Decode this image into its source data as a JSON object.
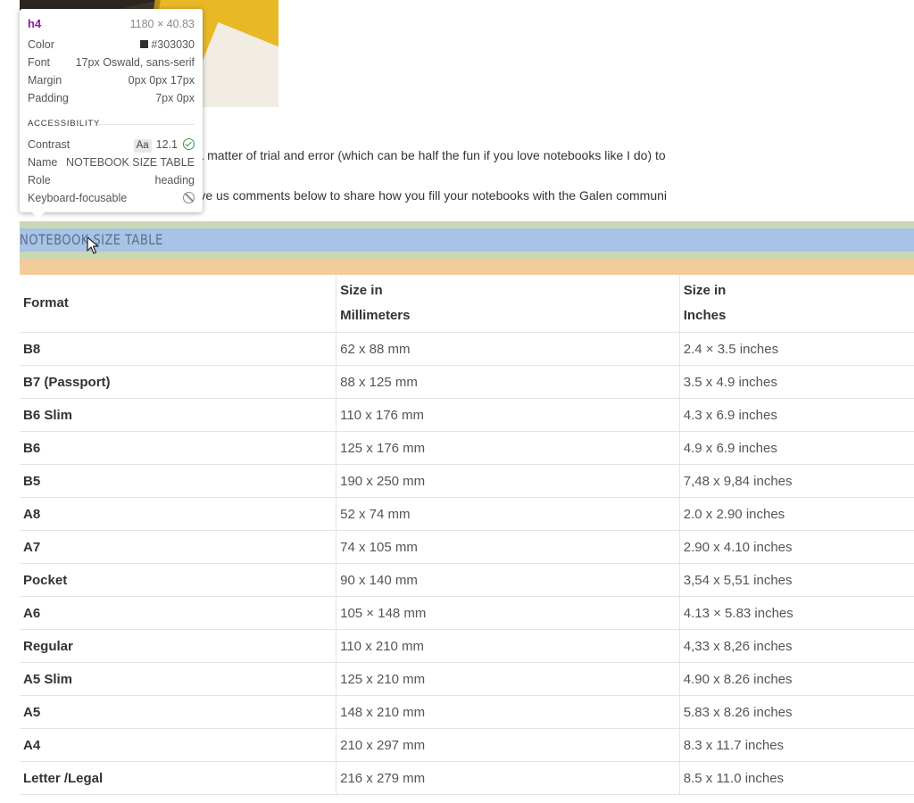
{
  "article": {
    "paragraph_1": "ok for your every need. It is just a matter of trial and error (which can be half the fun if you love notebooks like I do) to",
    "paragraph_2": "hoose to use different sizes. Leave us comments below to share how you fill your notebooks with the Galen communi",
    "section_heading": "NOTEBOOK SIZE TABLE"
  },
  "table": {
    "headers": {
      "format": "Format",
      "mm_line1": "Size in",
      "mm_line2": "Millimeters",
      "in_line1": "Size in",
      "in_line2": "Inches"
    },
    "rows": [
      {
        "format": "B8",
        "mm": "62 x 88 mm",
        "inches": "2.4 × 3.5 inches"
      },
      {
        "format": "B7 (Passport)",
        "mm": "88 x 125 mm",
        "inches": "3.5 x 4.9 inches"
      },
      {
        "format": "B6 Slim",
        "mm": "110 x 176 mm",
        "inches": "4.3 x 6.9 inches"
      },
      {
        "format": "B6",
        "mm": "125 x 176 mm",
        "inches": "4.9 x 6.9 inches"
      },
      {
        "format": "B5",
        "mm": "190 x 250 mm",
        "inches": "7,48 x 9,84 inches"
      },
      {
        "format": "A8",
        "mm": "52 x 74 mm",
        "inches": "2.0 x 2.90 inches"
      },
      {
        "format": "A7",
        "mm": "74 x 105 mm",
        "inches": "2.90 x 4.10 inches"
      },
      {
        "format": "Pocket",
        "mm": "90 x 140 mm",
        "inches": "3,54 x 5,51 inches"
      },
      {
        "format": "A6",
        "mm": "105 × 148 mm",
        "inches": "4.13 × 5.83 inches"
      },
      {
        "format": "Regular",
        "mm": "110 x 210 mm",
        "inches": "4,33 x 8,26 inches"
      },
      {
        "format": "A5 Slim",
        "mm": "125 x 210 mm",
        "inches": "4.90 x 8.26  inches"
      },
      {
        "format": "A5",
        "mm": "148 x 210 mm",
        "inches": "5.83 x 8.26  inches"
      },
      {
        "format": "A4",
        "mm": "210 x 297 mm",
        "inches": "8.3 x 11.7 inches"
      },
      {
        "format": "Letter /Legal",
        "mm": "216 x 279 mm",
        "inches": "8.5 x 11.0 inches"
      }
    ]
  },
  "inspector": {
    "tag": "h4",
    "dimensions": "1180 × 40.83",
    "color_label": "Color",
    "color_value": "#303030",
    "font_label": "Font",
    "font_value": "17px Oswald, sans-serif",
    "margin_label": "Margin",
    "margin_value": "0px 0px 17px",
    "padding_label": "Padding",
    "padding_value": "7px 0px",
    "section_title": "ACCESSIBILITY",
    "contrast_label": "Contrast",
    "contrast_badge": "Aa",
    "contrast_value": "12.1",
    "name_label": "Name",
    "name_value": "NOTEBOOK SIZE TABLE",
    "role_label": "Role",
    "role_value": "heading",
    "keyboard_label": "Keyboard-focusable"
  },
  "colors": {
    "heading_text": "#5b6f8d",
    "band_blue": "#a7c3e5",
    "band_green": "#c9d9b4",
    "band_orange": "#f3cc9c",
    "inspector_tag": "#8a1f9e",
    "contrast_pass": "#2e9e4b"
  },
  "icons": {
    "contrast_status": "check-circle-icon",
    "keyboard_status": "no-entry-icon",
    "pointer": "mouse-cursor-icon"
  }
}
